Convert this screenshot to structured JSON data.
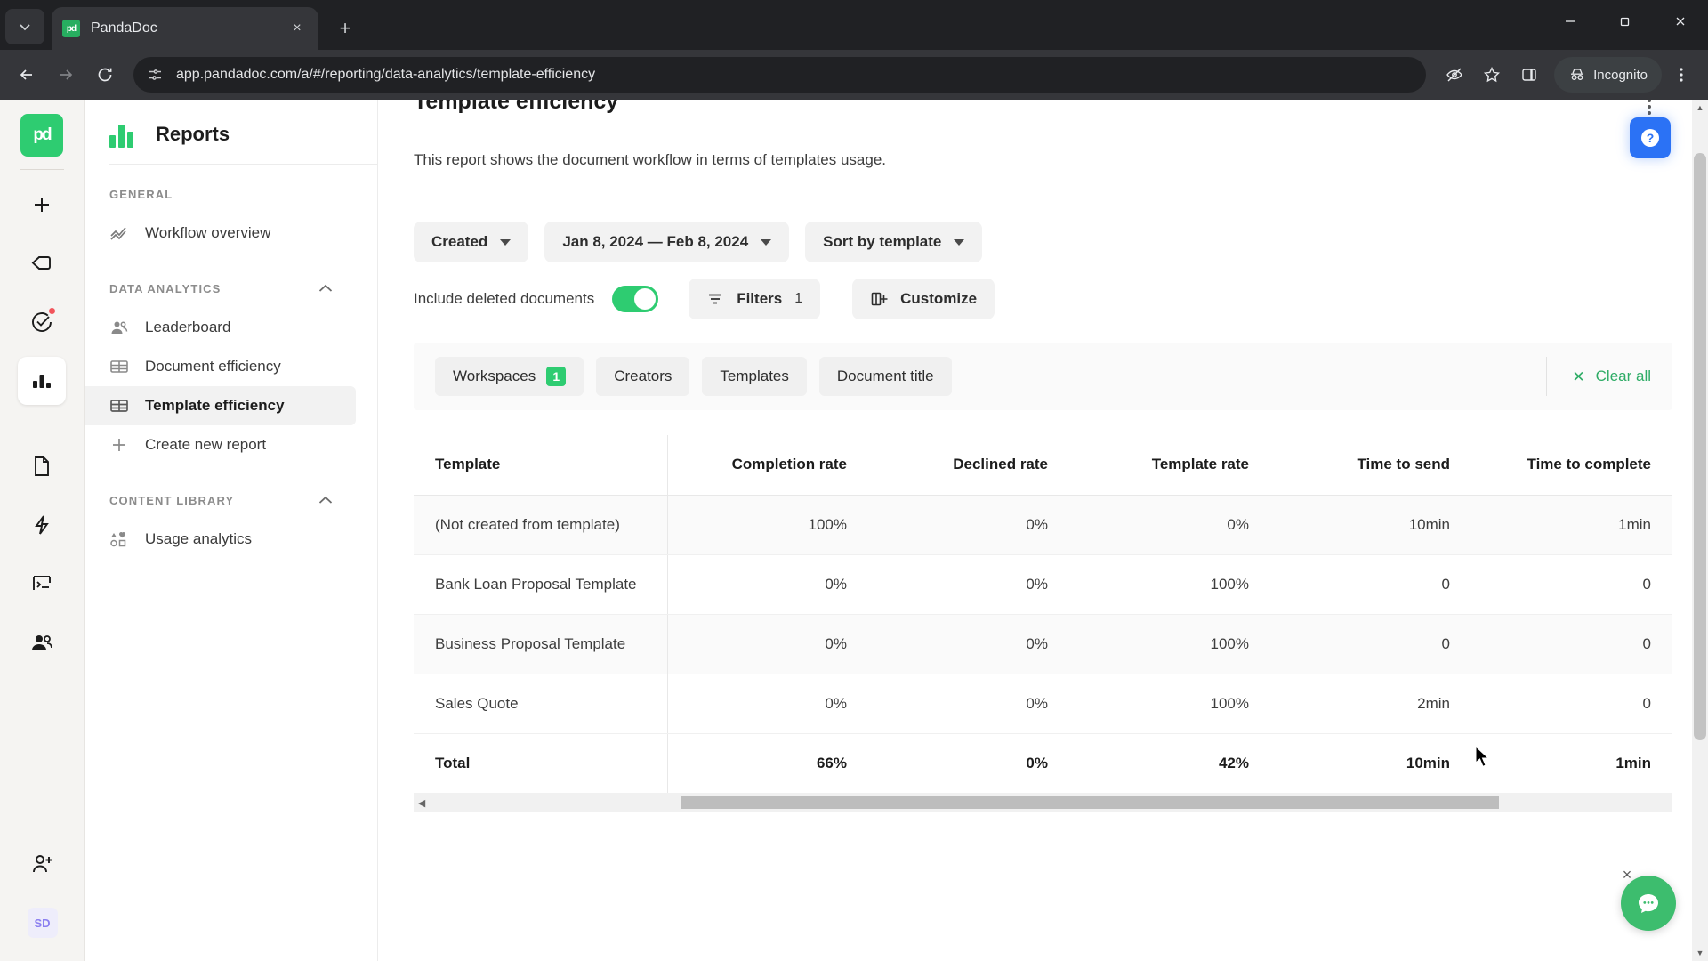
{
  "browser": {
    "tab": {
      "title": "PandaDoc",
      "favicon": "pandadoc-favicon",
      "close_label": "×"
    },
    "tablist_menu": "tab-search-icon",
    "new_tab_label": "+",
    "url": "app.pandadoc.com/a/#/reporting/data-analytics/template-efficiency",
    "profile_label": "Incognito",
    "window_controls": {
      "minimize": "minimize-icon",
      "maximize": "maximize-icon",
      "close": "close-icon"
    },
    "omnibox_icons": [
      "site-info-icon",
      "tracking-protection-icon",
      "bookmark-star-icon",
      "side-panel-icon"
    ],
    "menu": "browser-menu-icon"
  },
  "rail": {
    "logo": "pd",
    "items": [
      {
        "name": "create-new",
        "icon": "plus-icon",
        "badge": false
      },
      {
        "name": "home",
        "icon": "home-pentagon-icon",
        "badge": false
      },
      {
        "name": "tasks",
        "icon": "check-circle-icon",
        "badge": true
      },
      {
        "name": "reports",
        "icon": "bar-chart-icon",
        "badge": false,
        "active": true
      },
      {
        "name": "documents",
        "icon": "document-icon",
        "badge": false
      },
      {
        "name": "automations",
        "icon": "lightning-icon",
        "badge": false
      },
      {
        "name": "forms",
        "icon": "form-icon",
        "badge": false
      },
      {
        "name": "contacts",
        "icon": "people-icon",
        "badge": false
      }
    ],
    "invite": "add-person-icon",
    "avatar": "SD"
  },
  "leftnav": {
    "title": "Reports",
    "groups": [
      {
        "label": "GENERAL",
        "collapsible": false,
        "items": [
          {
            "label": "Workflow overview",
            "icon": "trend-line-icon",
            "active": false
          }
        ]
      },
      {
        "label": "DATA ANALYTICS",
        "collapsible": true,
        "items": [
          {
            "label": "Leaderboard",
            "icon": "people-icon",
            "active": false
          },
          {
            "label": "Document efficiency",
            "icon": "table-icon",
            "active": false
          },
          {
            "label": "Template efficiency",
            "icon": "table-icon",
            "active": true
          },
          {
            "label": "Create new report",
            "icon": "plus-icon",
            "active": false
          }
        ]
      },
      {
        "label": "CONTENT LIBRARY",
        "collapsible": true,
        "items": [
          {
            "label": "Usage analytics",
            "icon": "shapes-icon",
            "active": false
          }
        ]
      }
    ]
  },
  "report": {
    "title": "Template efficiency",
    "description": "This report shows the document workflow in terms of templates usage.",
    "kebab": "more-options-icon",
    "help_button": "help-question-icon"
  },
  "toolbar": {
    "date_type": "Created",
    "date_range": "Jan 8, 2024 — Feb 8, 2024",
    "sort_by": "Sort by template",
    "include_deleted_label": "Include deleted documents",
    "include_deleted_on": true,
    "filters_label": "Filters",
    "filters_count": "1",
    "customize_label": "Customize"
  },
  "chips": {
    "items": [
      {
        "label": "Workspaces",
        "badge": "1"
      },
      {
        "label": "Creators",
        "badge": ""
      },
      {
        "label": "Templates",
        "badge": ""
      },
      {
        "label": "Document title",
        "badge": ""
      }
    ],
    "clear_all": "Clear all"
  },
  "table": {
    "columns": [
      "Template",
      "Completion rate",
      "Declined rate",
      "Template rate",
      "Time to send",
      "Time to complete"
    ],
    "rows": [
      {
        "cells": [
          "(Not created from template)",
          "100%",
          "0%",
          "0%",
          "10min",
          "1min"
        ]
      },
      {
        "cells": [
          "Bank Loan Proposal Template",
          "0%",
          "0%",
          "100%",
          "0",
          "0"
        ]
      },
      {
        "cells": [
          "Business Proposal Template",
          "0%",
          "0%",
          "100%",
          "0",
          "0"
        ]
      },
      {
        "cells": [
          "Sales Quote",
          "0%",
          "0%",
          "100%",
          "2min",
          "0"
        ]
      }
    ],
    "total": {
      "cells": [
        "Total",
        "66%",
        "0%",
        "42%",
        "10min",
        "1min"
      ]
    }
  },
  "widgets": {
    "chat_bubble": "chat-icon",
    "chat_close": "×"
  },
  "colors": {
    "brand_green": "#2ecc71",
    "accent_blue": "#2b72f5",
    "chat_green": "#3dbd6e",
    "badge_red": "#f2545b"
  }
}
